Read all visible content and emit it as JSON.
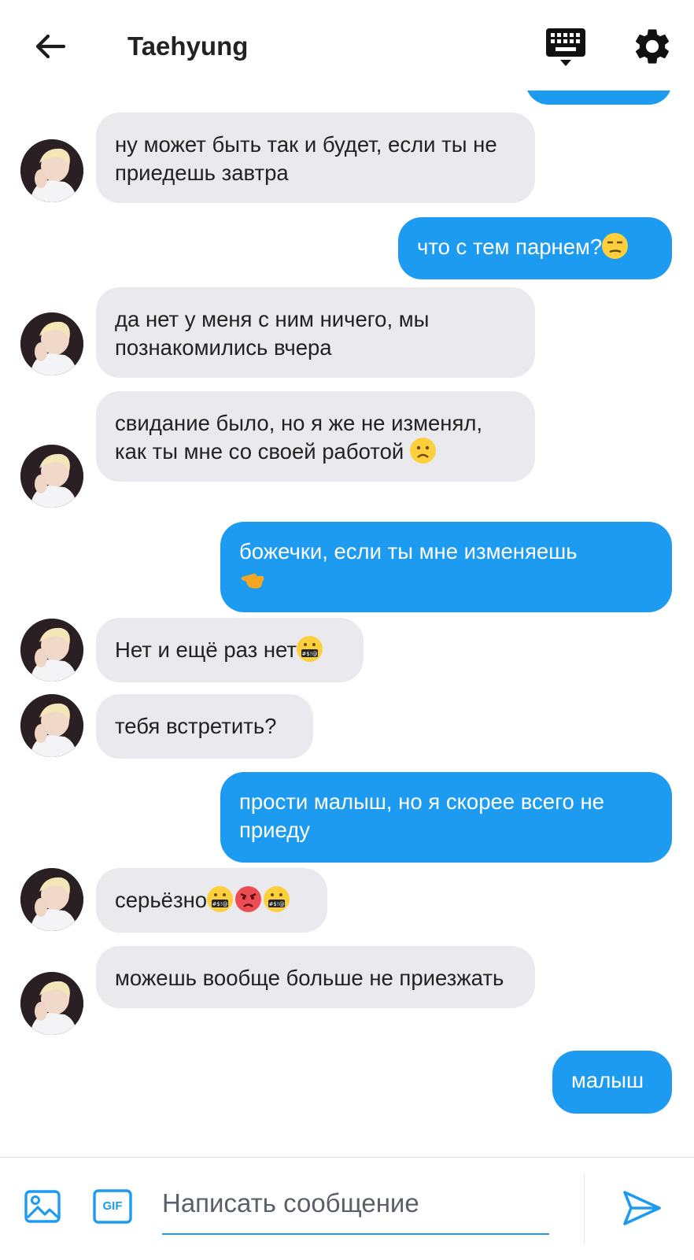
{
  "header": {
    "title": "Taehyung",
    "back_icon": "arrow-left-icon",
    "keyboard_icon": "keyboard-icon",
    "settings_icon": "gear-icon"
  },
  "messages": [
    {
      "side": "in",
      "text": "ну может быть так и будет, если ты не приедешь завтра"
    },
    {
      "side": "out",
      "text": "что с тем парнем?",
      "emoji": "unamused-face"
    },
    {
      "side": "in",
      "text": "да нет у меня с ним ничего, мы познакомились вчера"
    },
    {
      "side": "in",
      "text": "свидание было, но я же не изменял, как ты мне со своей работой",
      "emoji": "slightly-frowning-face"
    },
    {
      "side": "out",
      "text": "божечки, если ты мне изменяешь",
      "emoji": "backhand-index-pointing-left"
    },
    {
      "side": "in",
      "text": "Нет и ещё раз нет",
      "emoji": "face-with-symbols-on-mouth"
    },
    {
      "side": "in",
      "text": "тебя встретить?"
    },
    {
      "side": "out",
      "text": "прости малыш, но я скорее всего не приеду"
    },
    {
      "side": "in",
      "text": "серьёзно",
      "emoji": "face-with-symbols-on-mouth, pouting-face, face-with-symbols-on-mouth"
    },
    {
      "side": "in",
      "text": "можешь вообще больше не приезжать"
    },
    {
      "side": "out",
      "text": "малыш"
    }
  ],
  "composer": {
    "placeholder": "Написать сообщение",
    "gif_label": "GIF",
    "image_icon": "image-icon",
    "send_icon": "send-icon"
  },
  "colors": {
    "accent": "#1d9bf0",
    "incoming_bubble": "#e9e9ee",
    "outgoing_text": "#ffffff"
  }
}
